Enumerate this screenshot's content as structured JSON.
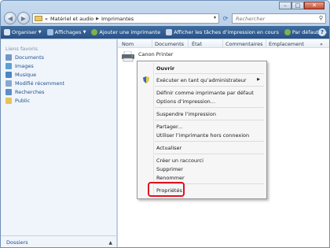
{
  "window": {
    "address": {
      "crumbs": [
        "«",
        "Matériel et audio",
        "Imprimantes"
      ],
      "search_placeholder": "Rechercher"
    }
  },
  "toolbar": {
    "items": [
      "Organiser",
      "Affichages",
      "Ajouter une imprimante",
      "Afficher les tâches d’impression en cours",
      "Par défaut",
      "»"
    ]
  },
  "sidebar": {
    "title": "Liens favoris",
    "items": [
      "Documents",
      "Images",
      "Musique",
      "Modifié récemment",
      "Recherches",
      "Public"
    ],
    "footer": "Dossiers"
  },
  "columns": [
    "Nom",
    "Documents",
    "État",
    "Commentaires",
    "Emplacement",
    "»"
  ],
  "printer": {
    "name": "Canon Printer"
  },
  "context_menu": {
    "items": [
      "Ouvrir",
      "Exécuter en tant qu’administrateur",
      "Définir comme imprimante par défaut",
      "Options d’impression...",
      "Suspendre l’impression",
      "Partager...",
      "Utiliser l’imprimante hors connexion",
      "Actualiser",
      "Créer un raccourci",
      "Supprimer",
      "Renommer",
      "Propriétés"
    ]
  },
  "colors": {
    "toolbar": "#2e5a8f",
    "highlight": "#e0101f",
    "link": "#1c4f8f"
  }
}
